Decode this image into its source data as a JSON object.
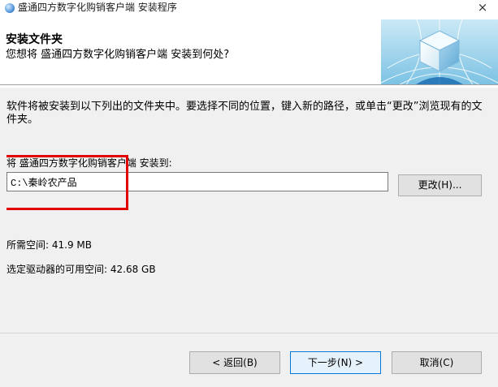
{
  "window": {
    "title": "盛通四方数字化购销客户端 安装程序",
    "close_symbol": "×"
  },
  "header": {
    "title": "安装文件夹",
    "subtitle": "您想将 盛通四方数字化购销客户端 安装到何处?"
  },
  "body": {
    "instruction": "软件将被安装到以下列出的文件夹中。要选择不同的位置，键入新的路径，或单击“更改”浏览现有的文件夹。",
    "install_label": "将 盛通四方数字化购销客户端 安装到:",
    "install_path": "C:\\秦岭农产品",
    "browse_label": "更改(H)...",
    "space_required": "所需空间: 41.9 MB",
    "space_available": "选定驱动器的可用空间: 42.68 GB"
  },
  "footer": {
    "back_label": "< 返回(B)",
    "next_label": "下一步(N) >",
    "cancel_label": "取消(C)"
  },
  "colors": {
    "highlight_box": "#e00000",
    "window_bg": "#f0f0f0",
    "primary_button_border": "#0078d7"
  }
}
